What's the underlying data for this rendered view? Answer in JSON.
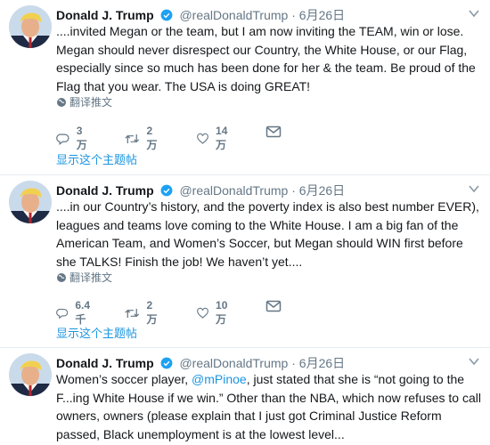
{
  "colors": {
    "link": "#1b95e0",
    "muted": "#657786",
    "text": "#14171a",
    "divider": "#e6ecf0"
  },
  "tweets": [
    {
      "name": "Donald J. Trump",
      "handle": "@realDonaldTrump",
      "sep": "·",
      "time": "6月26日",
      "text": "....invited Megan or the team, but I am now inviting the TEAM, win or lose. Megan should never disrespect our Country, the White House, or our Flag, especially since so much has been done for her & the team. Be proud of the Flag that you wear. The USA is doing GREAT!",
      "translate_label": "翻译推文",
      "reply_count": "3万",
      "retweet_count": "2万",
      "like_count": "14万",
      "thread_label": "显示这个主题帖"
    },
    {
      "name": "Donald J. Trump",
      "handle": "@realDonaldTrump",
      "sep": "·",
      "time": "6月26日",
      "text": "....in our Country’s history, and the poverty index is also best number EVER), leagues and teams love coming to the White House. I am a big fan of the American Team, and Women’s Soccer, but Megan should WIN first before she TALKS! Finish the job! We haven’t yet....",
      "translate_label": "翻译推文",
      "reply_count": "6.4千",
      "retweet_count": "2万",
      "like_count": "10万",
      "thread_label": "显示这个主题帖"
    },
    {
      "name": "Donald J. Trump",
      "handle": "@realDonaldTrump",
      "sep": "·",
      "time": "6月26日",
      "text_before": "Women’s soccer player, ",
      "mention": "@mPinoe",
      "text_after": ", just stated that she is “not going to the F...ing White House if we win.” Other than the NBA, which now refuses to call owners, owners (please explain that I just got Criminal Justice Reform passed, Black unemployment is at the lowest level..."
    }
  ]
}
